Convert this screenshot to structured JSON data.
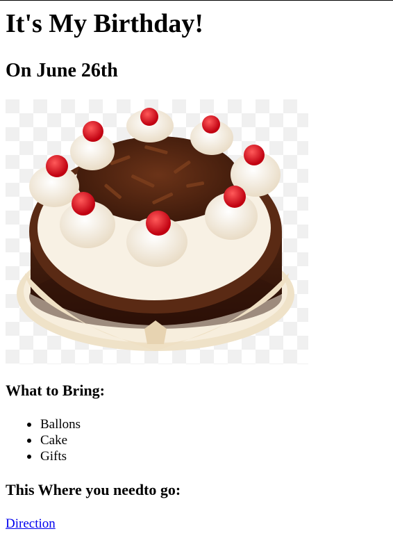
{
  "page": {
    "title": "It's My Birthday!",
    "subtitle": "On June 26th"
  },
  "cake_image": {
    "icon": "cake-icon",
    "colors": {
      "checker_light": "#f0f0f0",
      "cake_dark": "#3a1a0e",
      "cake_mid": "#5a2a14",
      "cream": "#fbf6ec",
      "cherry": "#e0141e"
    }
  },
  "bring": {
    "heading": "What to Bring:",
    "items": [
      "Ballons",
      "Cake",
      "Gifts"
    ]
  },
  "where": {
    "heading": "This Where you needto go:",
    "link_text": "Direction"
  },
  "colors": {
    "link": "#0000ee",
    "text": "#000000"
  }
}
